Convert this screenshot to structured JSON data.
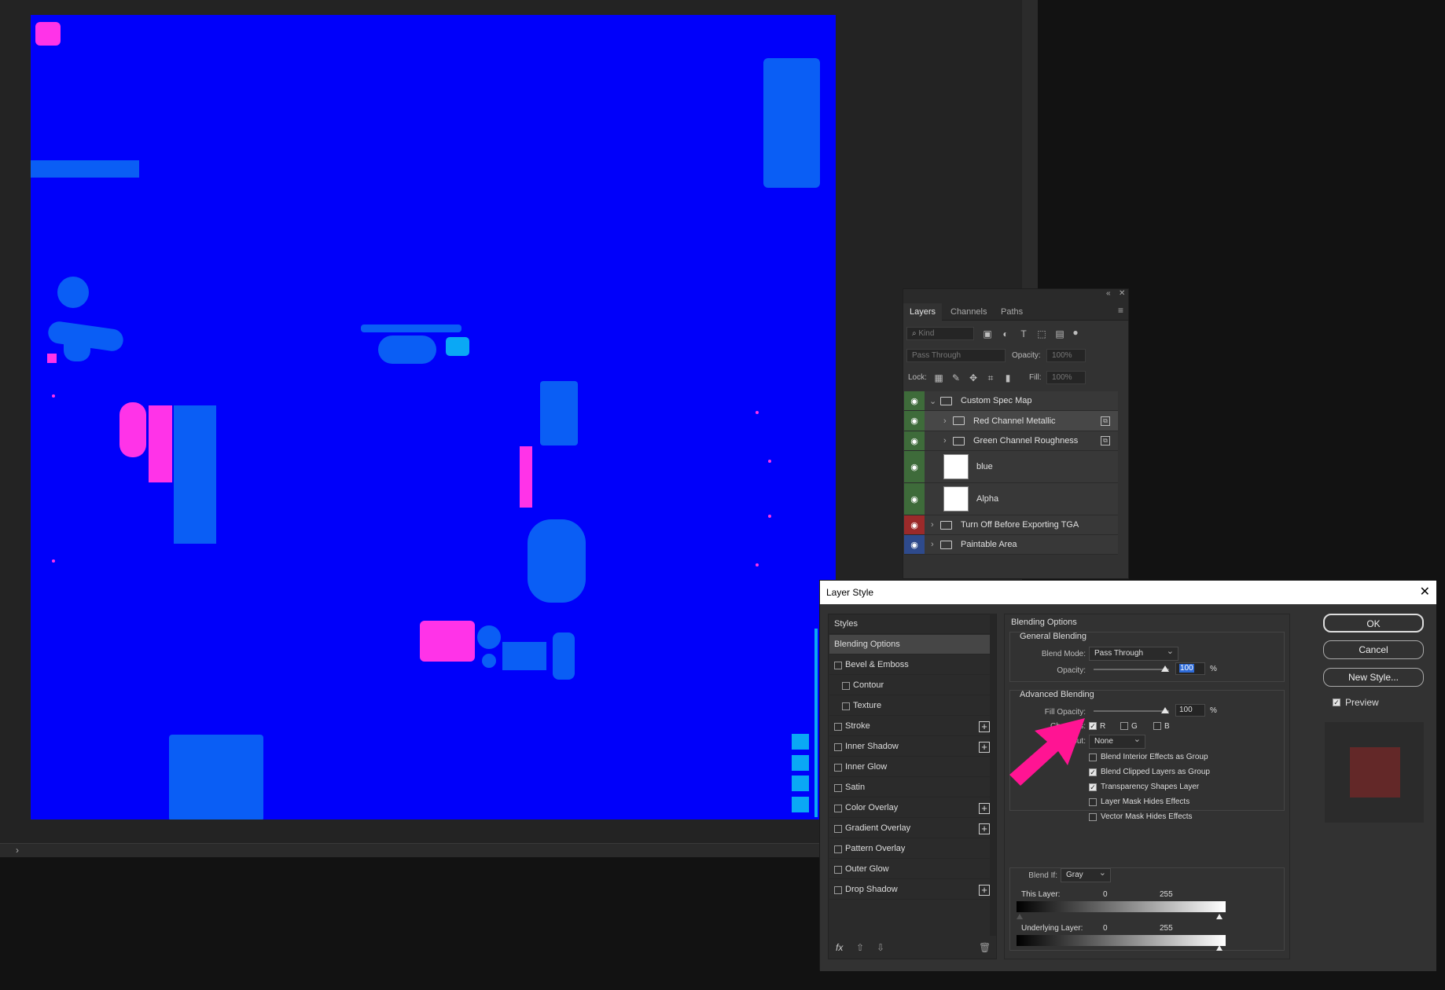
{
  "layers_panel": {
    "tabs": [
      "Layers",
      "Channels",
      "Paths"
    ],
    "filter_placeholder": "Kind",
    "blend_mode": "Pass Through",
    "opacity_label": "Opacity:",
    "opacity_value": "100%",
    "lock_label": "Lock:",
    "fill_label": "Fill:",
    "fill_value": "100%",
    "layers": [
      {
        "name": "Custom Spec Map",
        "type": "group",
        "eye_color": "#3e6b3a",
        "expanded": true
      },
      {
        "name": "Red Channel Metallic",
        "type": "group",
        "eye_color": "#3e6b3a",
        "selected": true
      },
      {
        "name": "Green Channel Roughness",
        "type": "group",
        "eye_color": "#3e6b3a"
      },
      {
        "name": "blue",
        "type": "layer",
        "eye_color": "#3e6b3a"
      },
      {
        "name": "Alpha",
        "type": "layer",
        "eye_color": "#3e6b3a"
      },
      {
        "name": "Turn Off Before Exporting TGA",
        "type": "group",
        "eye_color": "#9b2a2a"
      },
      {
        "name": "Paintable Area",
        "type": "group",
        "eye_color": "#2e4a8c"
      }
    ]
  },
  "dialog": {
    "title": "Layer Style",
    "styles_header": "Styles",
    "style_items": [
      {
        "label": "Blending Options",
        "checkbox": false,
        "plus": false,
        "selected": true,
        "indent": 0
      },
      {
        "label": "Bevel & Emboss",
        "checkbox": true,
        "plus": false,
        "indent": 0
      },
      {
        "label": "Contour",
        "checkbox": true,
        "plus": false,
        "indent": 1
      },
      {
        "label": "Texture",
        "checkbox": true,
        "plus": false,
        "indent": 1
      },
      {
        "label": "Stroke",
        "checkbox": true,
        "plus": true,
        "indent": 0
      },
      {
        "label": "Inner Shadow",
        "checkbox": true,
        "plus": true,
        "indent": 0
      },
      {
        "label": "Inner Glow",
        "checkbox": true,
        "plus": false,
        "indent": 0
      },
      {
        "label": "Satin",
        "checkbox": true,
        "plus": false,
        "indent": 0
      },
      {
        "label": "Color Overlay",
        "checkbox": true,
        "plus": true,
        "indent": 0
      },
      {
        "label": "Gradient Overlay",
        "checkbox": true,
        "plus": true,
        "indent": 0
      },
      {
        "label": "Pattern Overlay",
        "checkbox": true,
        "plus": false,
        "indent": 0
      },
      {
        "label": "Outer Glow",
        "checkbox": true,
        "plus": false,
        "indent": 0
      },
      {
        "label": "Drop Shadow",
        "checkbox": true,
        "plus": true,
        "indent": 0
      }
    ],
    "blending_options_title": "Blending Options",
    "general_blending_title": "General Blending",
    "blend_mode_label": "Blend Mode:",
    "blend_mode_value": "Pass Through",
    "opacity_label": "Opacity:",
    "opacity_value": "100",
    "percent": "%",
    "advanced_blending_title": "Advanced Blending",
    "fill_opacity_label": "Fill Opacity:",
    "fill_opacity_value": "100",
    "channels_label": "Channels:",
    "channel_r": "R",
    "channel_g": "G",
    "channel_b": "B",
    "knockout_label": "out:",
    "knockout_value": "None",
    "adv_options": [
      {
        "label": "Blend Interior Effects as Group",
        "checked": false
      },
      {
        "label": "Blend Clipped Layers as Group",
        "checked": true
      },
      {
        "label": "Transparency Shapes Layer",
        "checked": true
      },
      {
        "label": "Layer Mask Hides Effects",
        "checked": false
      },
      {
        "label": "Vector Mask Hides Effects",
        "checked": false
      }
    ],
    "blend_if_label": "Blend If:",
    "blend_if_value": "Gray",
    "this_layer_label": "This Layer:",
    "underlying_layer_label": "Underlying Layer:",
    "range_min": "0",
    "range_max": "255",
    "ok_label": "OK",
    "cancel_label": "Cancel",
    "new_style_label": "New Style...",
    "preview_label": "Preview",
    "preview_color": "#632828"
  },
  "colors": {
    "canvas_blue": "#0000fa",
    "shape_blue": "#0a5ef5",
    "shape_pink": "#ff33e8",
    "annotation_arrow": "#ff1493"
  }
}
